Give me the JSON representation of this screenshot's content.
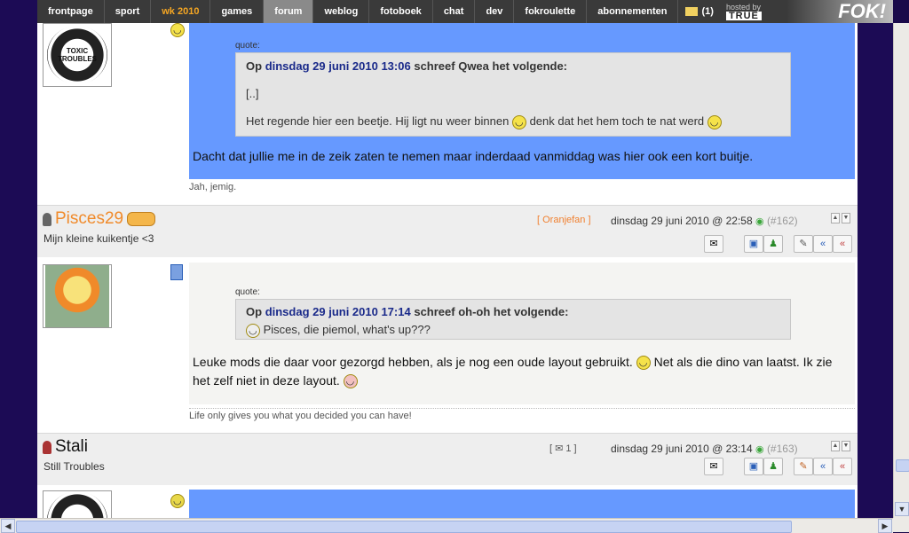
{
  "nav": {
    "items": [
      "frontpage",
      "sport",
      "wk 2010",
      "games",
      "forum",
      "weblog",
      "fotoboek",
      "chat",
      "dev",
      "fokroulette",
      "abonnementen"
    ],
    "mail_count": "(1)",
    "hosted_by": "hosted by",
    "host_logo": "TRUE",
    "site_logo": "FOK!"
  },
  "post1": {
    "quote_label": "quote:",
    "quote_prefix": "Op",
    "quote_date": "dinsdag 29 juni 2010 13:06",
    "quote_suffix": "schreef Qwea het volgende:",
    "quote_ellipsis": "[..]",
    "quote_text_a": "Het regende hier een beetje. Hij ligt nu weer binnen",
    "quote_text_b": "denk dat het hem toch te nat werd",
    "message": "Dacht dat jullie me in de zeik zaten te nemen maar inderdaad vanmiddag was hier ook een kort buitje.",
    "signature": "Jah, jemig."
  },
  "post2": {
    "username": "Pisces29",
    "user_title": "Mijn kleine kuikentje <3",
    "badge": "[ Oranjefan ]",
    "datetime": "dinsdag 29 juni 2010 @ 22:58",
    "post_number": "(#162)",
    "quote_label": "quote:",
    "quote_prefix": "Op",
    "quote_date": "dinsdag 29 juni 2010 17:14",
    "quote_suffix": "schreef oh-oh het volgende:",
    "quote_text": "Pisces, die piemol, what's up???",
    "message_a": "Leuke mods die daar voor gezorgd hebben, als je nog een oude layout gebruikt.",
    "message_b": "Net als die dino van laatst. Ik zie het zelf niet in deze layout.",
    "signature": "Life only gives you what you decided you can have!"
  },
  "post3": {
    "username": "Stali",
    "user_title": "Still Troubles",
    "badge": "[ ✉ 1 ]",
    "datetime": "dinsdag 29 juni 2010 @ 23:14",
    "post_number": "(#163)"
  },
  "avatar_text": "TOXIC TROUBLES",
  "colors": {
    "blue_msg": "#6699ff",
    "orange_name": "#f08a2a",
    "date_link": "#1a2a8a"
  }
}
